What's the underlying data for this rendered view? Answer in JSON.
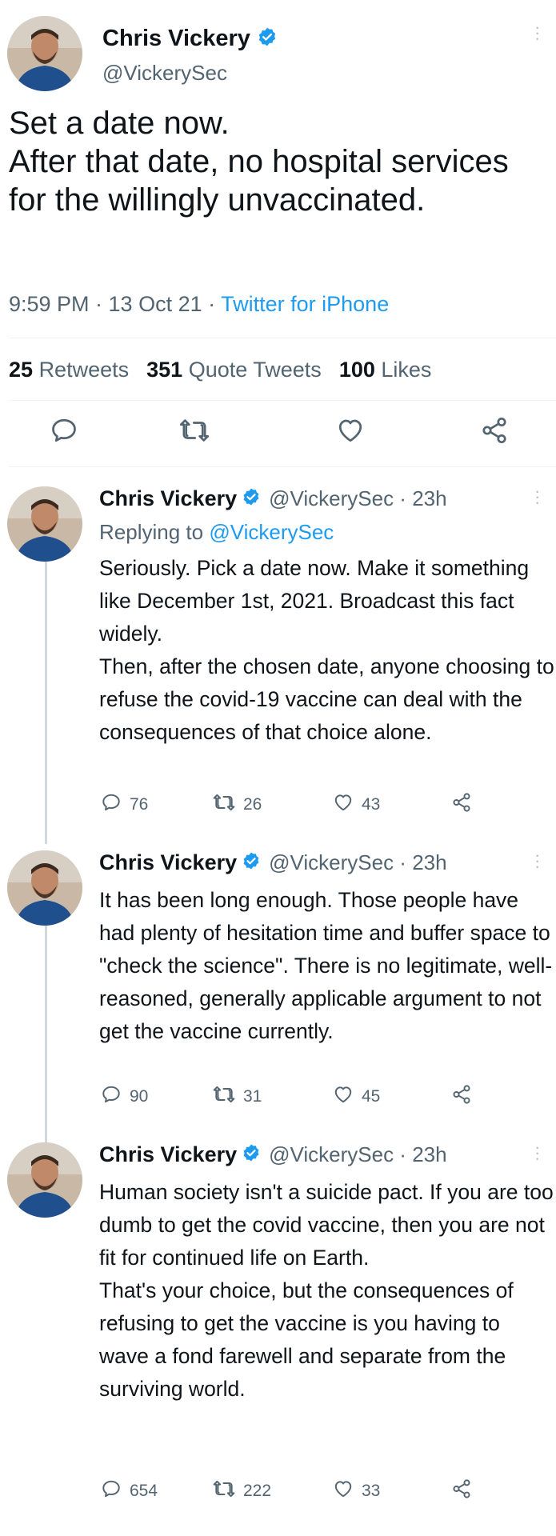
{
  "main_tweet": {
    "author_name": "Chris Vickery",
    "handle": "@VickerySec",
    "text": "Set a date now.\nAfter that date, no hospital services for the willingly unvaccinated.",
    "time": "9:59 PM · 13 Oct 21 ·",
    "source": "Twitter for iPhone",
    "stats": {
      "retweets_count": "25",
      "retweets_label": "Retweets",
      "quotes_count": "351",
      "quotes_label": "Quote Tweets",
      "likes_count": "100",
      "likes_label": "Likes"
    },
    "icons": [
      "reply-icon",
      "retweet-icon",
      "like-icon",
      "share-icon"
    ]
  },
  "replies": [
    {
      "author_name": "Chris Vickery",
      "handle_time": "@VickerySec · 23h",
      "replying_prefix": "Replying to",
      "replying_to": "@VickerySec",
      "text": "Seriously. Pick a date now. Make it something like December 1st, 2021. Broadcast this fact widely.\nThen, after the chosen date, anyone choosing to refuse the covid-19 vaccine can deal with the consequences of that choice alone.",
      "replies": "76",
      "retweets": "26",
      "likes": "43"
    },
    {
      "author_name": "Chris Vickery",
      "handle_time": "@VickerySec · 23h",
      "text": "It has been long enough. Those people have had plenty of hesitation time and buffer space to \"check the science\". There is no legitimate, well-reasoned, generally applicable argument to not get the vaccine currently.",
      "replies": "90",
      "retweets": "31",
      "likes": "45"
    },
    {
      "author_name": "Chris Vickery",
      "handle_time": "@VickerySec · 23h",
      "text": "Human society isn't a suicide pact. If you are too dumb to get the covid vaccine, then you are not fit for continued life on Earth.\nThat's your choice, but the consequences of refusing to get the vaccine is you having to wave a fond farewell and separate from the surviving world.",
      "replies": "654",
      "retweets": "222",
      "likes": "33"
    }
  ],
  "colors": {
    "accent": "#1d9bf0",
    "text": "#0f1419",
    "secondary": "#536471",
    "thread_line": "#cfd9de"
  }
}
